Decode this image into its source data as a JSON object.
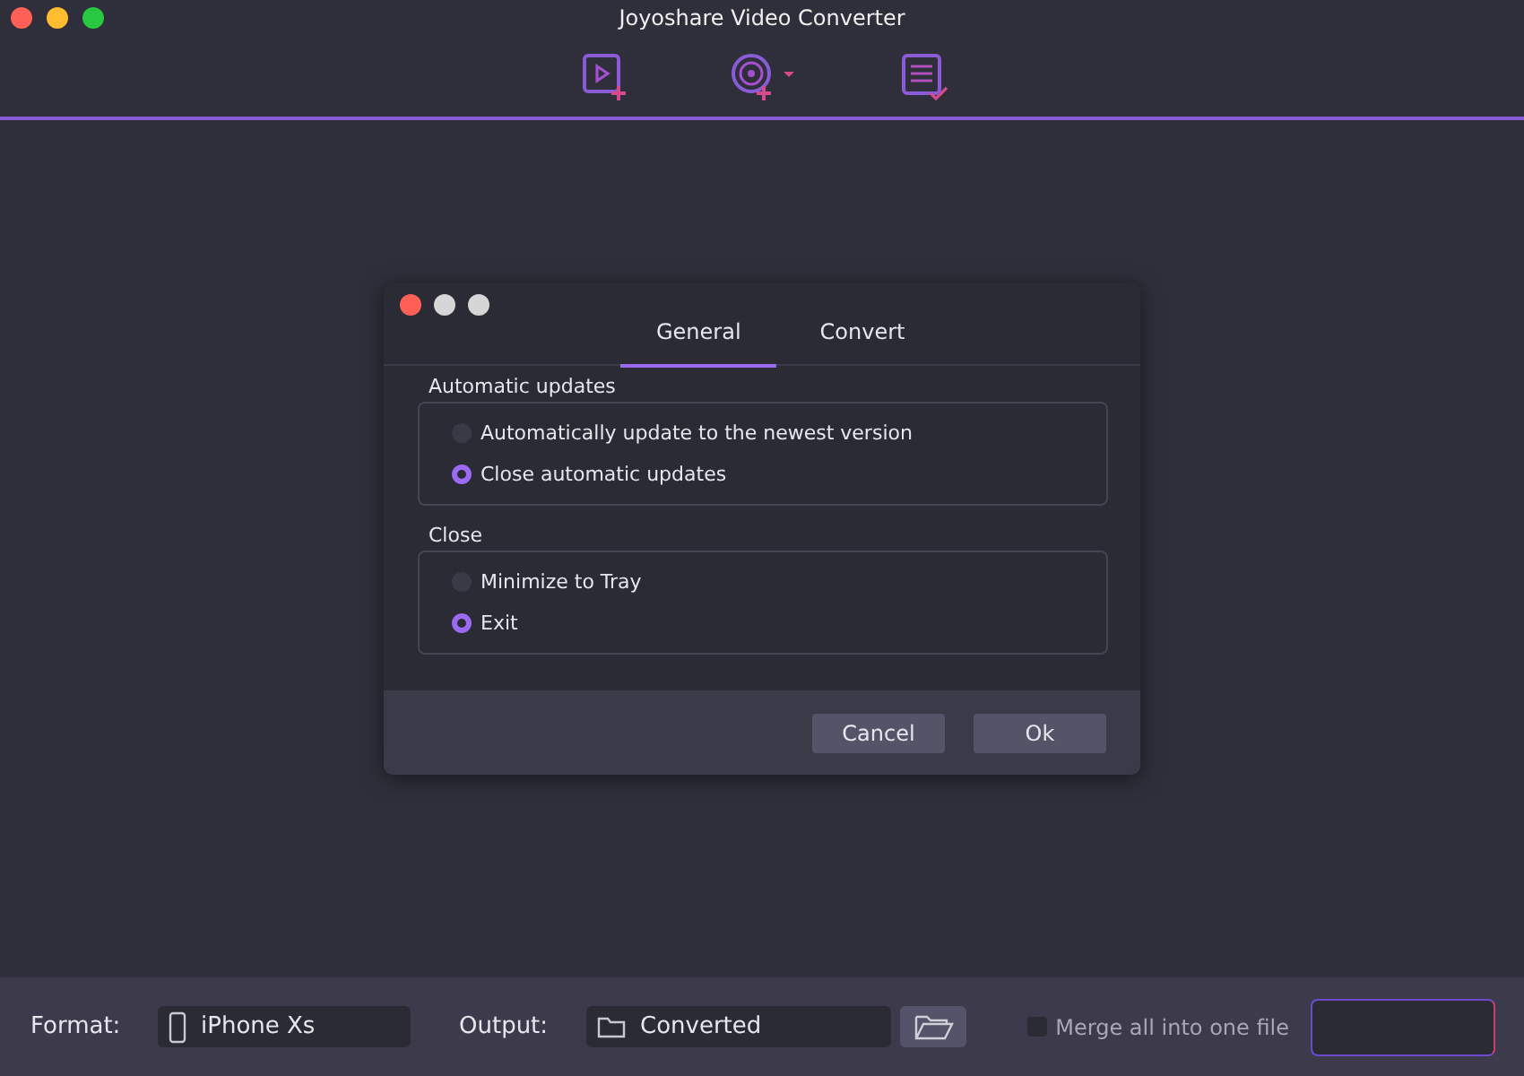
{
  "window": {
    "title": "Joyoshare Video Converter"
  },
  "dialog": {
    "tabs": [
      {
        "label": "General",
        "selected": true
      },
      {
        "label": "Convert",
        "selected": false
      }
    ],
    "groups": [
      {
        "title": "Automatic updates",
        "options": [
          {
            "label": "Automatically update to the newest version",
            "selected": false
          },
          {
            "label": "Close automatic updates",
            "selected": true
          }
        ]
      },
      {
        "title": "Close",
        "options": [
          {
            "label": "Minimize to Tray",
            "selected": false
          },
          {
            "label": "Exit",
            "selected": true
          }
        ]
      }
    ],
    "buttons": [
      "Cancel",
      "Ok"
    ]
  },
  "bottom_bar": {
    "format_label": "Format:",
    "format_value": "iPhone Xs",
    "output_label": "Output:",
    "output_value": "Converted",
    "merge": {
      "label": "Merge all into one file",
      "checked": false
    }
  }
}
